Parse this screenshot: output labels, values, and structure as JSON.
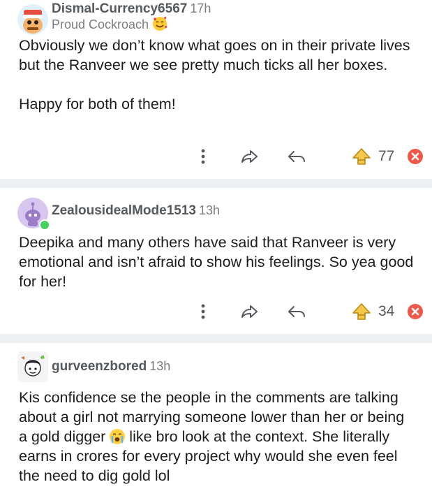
{
  "comments": [
    {
      "username": "Dismal-Currency6567",
      "time": "17h",
      "flair": "Proud Cockroach",
      "paragraphs": [
        "Obviously we don’t know what goes on in their private lives but the Ranveer we see pretty much ticks all her boxes.",
        "Happy for both of them!"
      ],
      "score": "77"
    },
    {
      "username": "ZealousidealMode1513",
      "time": "13h",
      "paragraphs": [
        "Deepika and many others have said that Ranveer is very emotional and isn’t afraid to show his feelings. So yea good for her!"
      ],
      "score": "34"
    },
    {
      "username": "gurveenzbored",
      "time": "13h",
      "body_before_emoji": "Kis confidence se the people in the comments are talking about a girl not marrying someone lower than her or being a gold digger",
      "body_after_emoji": " like bro look at the context. She literally earns in crores for every project why would she even feel the need to dig gold lol",
      "inline_emoji": "crying-face-emoji"
    }
  ],
  "icons": {
    "more": "more-vertical-icon",
    "share": "share-icon",
    "reply": "reply-icon",
    "upvote": "upvote-icon",
    "downvote": "downvote-icon"
  },
  "colors": {
    "upvote_yellow": "#f5c74a",
    "downvote_red": "#f0584a",
    "separator": "#eef1f3",
    "online_green": "#46d160"
  }
}
